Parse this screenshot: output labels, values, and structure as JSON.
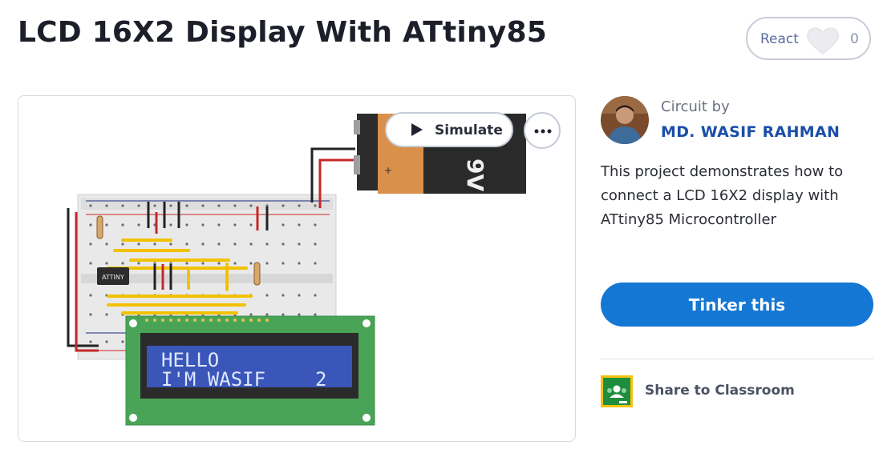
{
  "header": {
    "title": "LCD 16X2 Display With ATtiny85",
    "react_label": "React",
    "react_count": "0"
  },
  "canvas": {
    "simulate_label": "Simulate",
    "more_icon": "more-dots-icon",
    "chip_label": "ATTINY",
    "battery_label": "9V",
    "lcd_line1": "HELLO",
    "lcd_line2": "I'M WASIF",
    "lcd_counter": "2"
  },
  "author": {
    "prefix": "Circuit by",
    "name": "MD. WASIF RAHMAN"
  },
  "description": "This project demonstrates how to connect a LCD 16X2 display with ATtiny85 Microcontroller",
  "actions": {
    "tinker_label": "Tinker this",
    "share_label": "Share to Classroom"
  },
  "colors": {
    "accent": "#1477d4",
    "author_link": "#1a4ea8",
    "lcd_blue": "#3a56b8",
    "pcb_green": "#4aa457"
  }
}
